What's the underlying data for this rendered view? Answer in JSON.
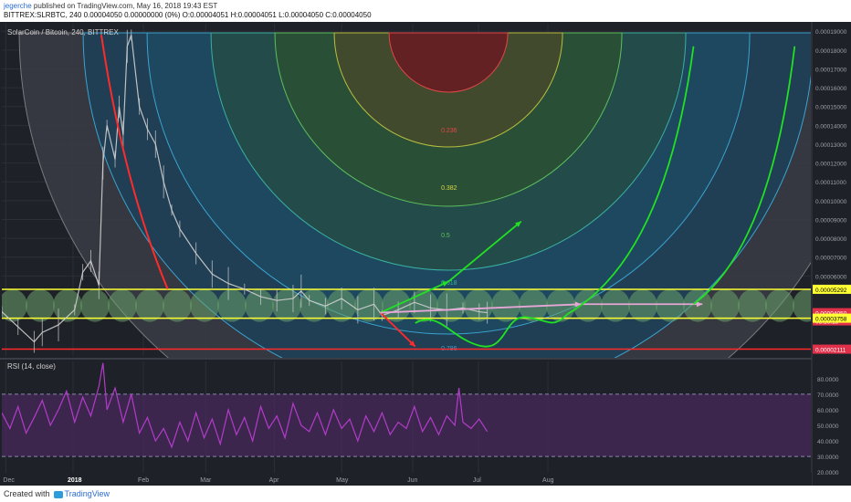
{
  "header": {
    "author": "jegerche",
    "published": "published on TradingView.com, May 16, 2018 19:43 EST",
    "ohlc": "BITTREX:SLRBTC, 240  0.00004050 0.00000000 (0%) O:0.00004051 H:0.00004051 L:0.00004050 C:0.00004050"
  },
  "footer": {
    "created_with": "Created with",
    "brand": "TradingView"
  },
  "chart_data": [
    {
      "type": "line",
      "title": "SolarCoin / Bitcoin, 240, BITTREX",
      "x_ticks": [
        "Dec",
        "2018",
        "Feb",
        "Mar",
        "Apr",
        "May",
        "Jun",
        "Jul",
        "Aug"
      ],
      "y_ticks": [
        "0.00019000",
        "0.00018000",
        "0.00017000",
        "0.00016000",
        "0.00015000",
        "0.00014000",
        "0.00013000",
        "0.00012000",
        "0.00011000",
        "0.00010000",
        "0.00009000",
        "0.00008000",
        "0.00007000",
        "0.00006000"
      ],
      "ylim": [
        1.75e-05,
        0.000194
      ],
      "price_labels": [
        {
          "text": "0.00005292",
          "value": 5.292e-05,
          "color": "#ffff33"
        },
        {
          "text": "0.00004050",
          "value": 4.05e-05,
          "color": "#e0304a"
        },
        {
          "text": "03:16:15",
          "value": 3.9e-05,
          "color": "#e0304a"
        },
        {
          "text": "0.00003758",
          "value": 3.758e-05,
          "color": "#ffff33"
        },
        {
          "text": "0.00002111",
          "value": 2.111e-05,
          "color": "#e0304a"
        }
      ],
      "horizontal_lines": [
        {
          "value": 5.292e-05,
          "color": "#ffff33"
        },
        {
          "value": 3.758e-05,
          "color": "#ffff33"
        },
        {
          "value": 2.111e-05,
          "color": "#ff2b2b"
        }
      ],
      "fib_levels": [
        "0.236",
        "0.382",
        "0.5",
        "0.618",
        "0.786"
      ],
      "price_series": [
        {
          "x": 0,
          "y": 4.1e-05
        },
        {
          "x": 0.02,
          "y": 3.3e-05
        },
        {
          "x": 0.04,
          "y": 2.5e-05
        },
        {
          "x": 0.05,
          "y": 3e-05
        },
        {
          "x": 0.07,
          "y": 3.4e-05
        },
        {
          "x": 0.09,
          "y": 4.2e-05
        },
        {
          "x": 0.1,
          "y": 6.2e-05
        },
        {
          "x": 0.11,
          "y": 6.8e-05
        },
        {
          "x": 0.12,
          "y": 5.5e-05
        },
        {
          "x": 0.125,
          "y": 0.00012
        },
        {
          "x": 0.13,
          "y": 0.00014
        },
        {
          "x": 0.14,
          "y": 0.000122
        },
        {
          "x": 0.145,
          "y": 0.00015
        },
        {
          "x": 0.15,
          "y": 0.000135
        },
        {
          "x": 0.155,
          "y": 0.000182
        },
        {
          "x": 0.16,
          "y": 0.000188
        },
        {
          "x": 0.17,
          "y": 0.00015
        },
        {
          "x": 0.18,
          "y": 0.000138
        },
        {
          "x": 0.19,
          "y": 0.00013
        },
        {
          "x": 0.2,
          "y": 0.00011
        },
        {
          "x": 0.21,
          "y": 9.5e-05
        },
        {
          "x": 0.22,
          "y": 8.5e-05
        },
        {
          "x": 0.24,
          "y": 7.2e-05
        },
        {
          "x": 0.26,
          "y": 6.1e-05
        },
        {
          "x": 0.28,
          "y": 5.6e-05
        },
        {
          "x": 0.3,
          "y": 5.3e-05
        },
        {
          "x": 0.32,
          "y": 4.9e-05
        },
        {
          "x": 0.34,
          "y": 4.7e-05
        },
        {
          "x": 0.36,
          "y": 4.8e-05
        },
        {
          "x": 0.37,
          "y": 5.2e-05
        },
        {
          "x": 0.38,
          "y": 4.7e-05
        },
        {
          "x": 0.4,
          "y": 4.4e-05
        },
        {
          "x": 0.42,
          "y": 4.8e-05
        },
        {
          "x": 0.44,
          "y": 4.2e-05
        },
        {
          "x": 0.46,
          "y": 4.5e-05
        },
        {
          "x": 0.47,
          "y": 3.9e-05
        },
        {
          "x": 0.49,
          "y": 4.2e-05
        },
        {
          "x": 0.51,
          "y": 4.6e-05
        },
        {
          "x": 0.53,
          "y": 4.3e-05
        },
        {
          "x": 0.55,
          "y": 4.2e-05
        },
        {
          "x": 0.57,
          "y": 4.3e-05
        },
        {
          "x": 0.59,
          "y": 4.1e-05
        },
        {
          "x": 0.6,
          "y": 4.05e-05
        }
      ]
    },
    {
      "type": "line",
      "title": "RSI (14, close)",
      "y_ticks": [
        "80.0000",
        "70.0000",
        "60.0000",
        "50.0000",
        "40.0000",
        "30.0000",
        "20.0000"
      ],
      "ylim": [
        16,
        91
      ],
      "overbought": 70,
      "oversold": 30,
      "series": [
        {
          "x": 0,
          "y": 58
        },
        {
          "x": 0.01,
          "y": 48
        },
        {
          "x": 0.02,
          "y": 62
        },
        {
          "x": 0.03,
          "y": 45
        },
        {
          "x": 0.04,
          "y": 55
        },
        {
          "x": 0.05,
          "y": 66
        },
        {
          "x": 0.06,
          "y": 50
        },
        {
          "x": 0.07,
          "y": 60
        },
        {
          "x": 0.08,
          "y": 72
        },
        {
          "x": 0.09,
          "y": 52
        },
        {
          "x": 0.1,
          "y": 68
        },
        {
          "x": 0.11,
          "y": 56
        },
        {
          "x": 0.12,
          "y": 75
        },
        {
          "x": 0.125,
          "y": 90
        },
        {
          "x": 0.13,
          "y": 60
        },
        {
          "x": 0.14,
          "y": 74
        },
        {
          "x": 0.15,
          "y": 52
        },
        {
          "x": 0.16,
          "y": 70
        },
        {
          "x": 0.17,
          "y": 45
        },
        {
          "x": 0.18,
          "y": 55
        },
        {
          "x": 0.19,
          "y": 40
        },
        {
          "x": 0.2,
          "y": 48
        },
        {
          "x": 0.21,
          "y": 36
        },
        {
          "x": 0.22,
          "y": 52
        },
        {
          "x": 0.23,
          "y": 40
        },
        {
          "x": 0.24,
          "y": 58
        },
        {
          "x": 0.25,
          "y": 42
        },
        {
          "x": 0.26,
          "y": 54
        },
        {
          "x": 0.27,
          "y": 38
        },
        {
          "x": 0.28,
          "y": 60
        },
        {
          "x": 0.29,
          "y": 44
        },
        {
          "x": 0.3,
          "y": 55
        },
        {
          "x": 0.31,
          "y": 40
        },
        {
          "x": 0.32,
          "y": 62
        },
        {
          "x": 0.33,
          "y": 48
        },
        {
          "x": 0.34,
          "y": 56
        },
        {
          "x": 0.35,
          "y": 42
        },
        {
          "x": 0.36,
          "y": 64
        },
        {
          "x": 0.37,
          "y": 50
        },
        {
          "x": 0.38,
          "y": 46
        },
        {
          "x": 0.39,
          "y": 58
        },
        {
          "x": 0.4,
          "y": 44
        },
        {
          "x": 0.41,
          "y": 60
        },
        {
          "x": 0.42,
          "y": 48
        },
        {
          "x": 0.43,
          "y": 54
        },
        {
          "x": 0.44,
          "y": 40
        },
        {
          "x": 0.45,
          "y": 56
        },
        {
          "x": 0.46,
          "y": 46
        },
        {
          "x": 0.47,
          "y": 58
        },
        {
          "x": 0.48,
          "y": 44
        },
        {
          "x": 0.49,
          "y": 52
        },
        {
          "x": 0.5,
          "y": 48
        },
        {
          "x": 0.51,
          "y": 62
        },
        {
          "x": 0.52,
          "y": 46
        },
        {
          "x": 0.53,
          "y": 55
        },
        {
          "x": 0.54,
          "y": 44
        },
        {
          "x": 0.55,
          "y": 56
        },
        {
          "x": 0.56,
          "y": 50
        },
        {
          "x": 0.565,
          "y": 74
        },
        {
          "x": 0.57,
          "y": 52
        },
        {
          "x": 0.58,
          "y": 48
        },
        {
          "x": 0.59,
          "y": 54
        },
        {
          "x": 0.6,
          "y": 46
        }
      ]
    }
  ],
  "colors": {
    "background": "#1f2128",
    "candles": "#cfcfcf",
    "rsi_line": "#b23cc9",
    "rsi_band": "#4a2a5e",
    "fib_ring": "#3ba3d0",
    "arrow_green": "#22e022",
    "arrow_red": "#ff2b2b",
    "arrow_pink": "#e6a6d6",
    "bubbles": "#6aa36a"
  }
}
